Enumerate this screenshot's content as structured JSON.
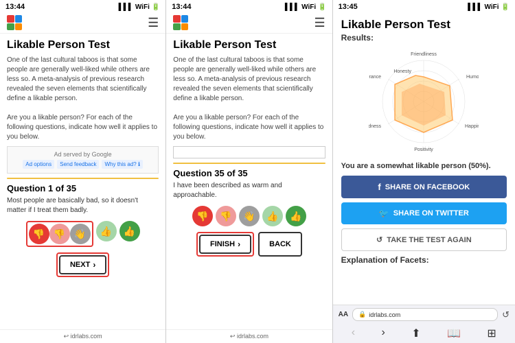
{
  "screens": [
    {
      "id": "screen1",
      "time": "13:44",
      "title": "Likable Person Test",
      "description": "One of the last cultural taboos is that some people are generally well-liked while others are less so. A meta-analysis of previous research revealed the seven elements that scientifically define a likable person.\n\nAre you a likable person? For each of the following questions, indicate how well it applies to you below.",
      "ad_text": "Ad served by Google",
      "ad_buttons": [
        "Ad options",
        "Send feedback",
        "Why this ad? ℹ"
      ],
      "question_label": "Question 1 of 35",
      "question_text": "Most people are basically bad, so it doesn't matter if I treat them badly.",
      "rating_buttons": [
        "👎",
        "👎",
        "👋",
        "👍",
        "👍"
      ],
      "rating_states": [
        "selected",
        "selected",
        "selected-gray",
        "normal",
        "normal"
      ],
      "nav_next_label": "NEXT",
      "footer": "idrlabs.com"
    },
    {
      "id": "screen2",
      "time": "13:44",
      "title": "Likable Person Test",
      "description": "One of the last cultural taboos is that some people are generally well-liked while others are less so. A meta-analysis of previous research revealed the seven elements that scientifically define a likable person.\n\nAre you a likable person? For each of the following questions, indicate how well it applies to you below.",
      "question_label": "Question 35 of 35",
      "question_text": "I have been described as warm and approachable.",
      "rating_buttons": [
        "👎",
        "👎",
        "👋",
        "👍",
        "👍"
      ],
      "nav_finish_label": "FINISH",
      "nav_back_label": "BACK",
      "footer": "idrlabs.com"
    },
    {
      "id": "screen3",
      "time": "13:45",
      "title": "Likable Person Test",
      "results_label": "Results:",
      "radar_labels": [
        "Friendliness",
        "Humor",
        "Happiness",
        "Kindness",
        "Positivity",
        "Tolerance",
        "Honesty"
      ],
      "radar_values": [
        0.6,
        0.5,
        0.55,
        0.45,
        0.7,
        0.5,
        0.55
      ],
      "result_text": "You are a somewhat likable person (50%).",
      "share_facebook": "SHARE ON FACEBOOK",
      "share_twitter": "SHARE ON TWITTER",
      "retake": "TAKE THE TEST AGAIN",
      "explanation_label": "Explanation of Facets:",
      "browser_url": "idrlabs.com",
      "browser_aa": "AA"
    }
  ]
}
